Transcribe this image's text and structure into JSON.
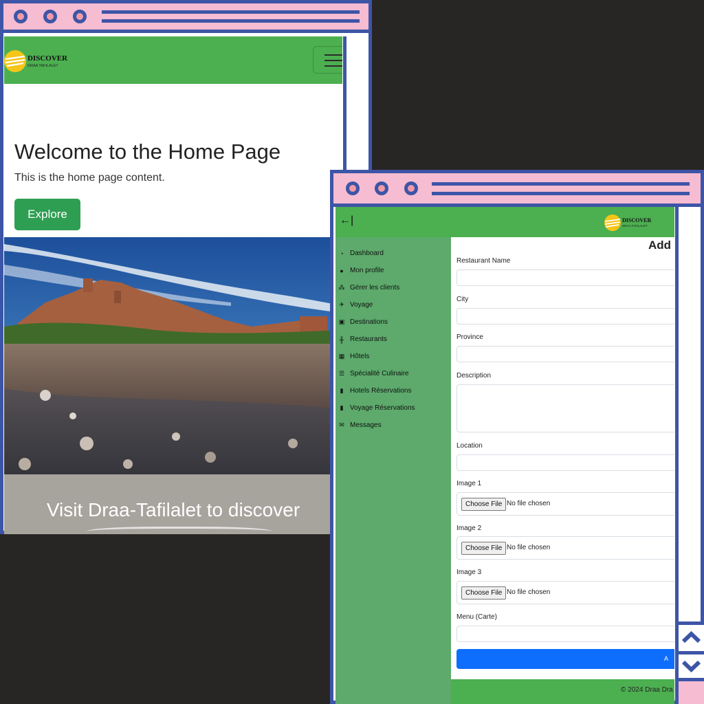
{
  "home_window": {
    "brand": {
      "line1": "DISCOVER",
      "line2": "DRAA TAFILALET"
    },
    "heading": "Welcome to the Home Page",
    "text": "This is the home page content.",
    "explore_label": "Explore",
    "caption": "Visit Draa-Tafilalet to discover"
  },
  "admin_window": {
    "back_icon": "←|",
    "brand": {
      "line1": "DISCOVER",
      "line2": "DRAA TAFILALET"
    },
    "sidebar": {
      "items": [
        {
          "label": "Dashboard",
          "icon": "dashboard-icon"
        },
        {
          "label": "Mon profile",
          "icon": "user-icon"
        },
        {
          "label": "Gérer les clients",
          "icon": "users-icon"
        },
        {
          "label": "Voyage",
          "icon": "plane-icon"
        },
        {
          "label": "Destinations",
          "icon": "map-icon"
        },
        {
          "label": "Restaurants",
          "icon": "utensils-icon"
        },
        {
          "label": "Hôtels",
          "icon": "hotel-icon"
        },
        {
          "label": "Spécialité Culinaire",
          "icon": "dish-icon"
        },
        {
          "label": "Hotels Réservations",
          "icon": "book-icon"
        },
        {
          "label": "Voyage Réservations",
          "icon": "book-icon"
        },
        {
          "label": "Messages",
          "icon": "envelope-icon"
        }
      ]
    },
    "form": {
      "title": "Add",
      "restaurant_name": {
        "label": "Restaurant Name",
        "value": ""
      },
      "city": {
        "label": "City",
        "value": ""
      },
      "province": {
        "label": "Province",
        "value": ""
      },
      "description": {
        "label": "Description",
        "value": ""
      },
      "location": {
        "label": "Location",
        "value": ""
      },
      "image1": {
        "label": "Image 1",
        "button": "Choose File",
        "status": "No file chosen"
      },
      "image2": {
        "label": "Image 2",
        "button": "Choose File",
        "status": "No file chosen"
      },
      "image3": {
        "label": "Image 3",
        "button": "Choose File",
        "status": "No file chosen"
      },
      "menu": {
        "label": "Menu (Carte)",
        "value": ""
      },
      "submit_label": "A"
    },
    "footer": "© 2024 Draa Dra"
  },
  "colors": {
    "frame": "#3d55a6",
    "titlebar": "#f5bcd2",
    "nav_green": "#4caf50",
    "sidebar_green": "#5daa6c",
    "primary_blue": "#0d6efd",
    "explore_green": "#2e9e52"
  }
}
